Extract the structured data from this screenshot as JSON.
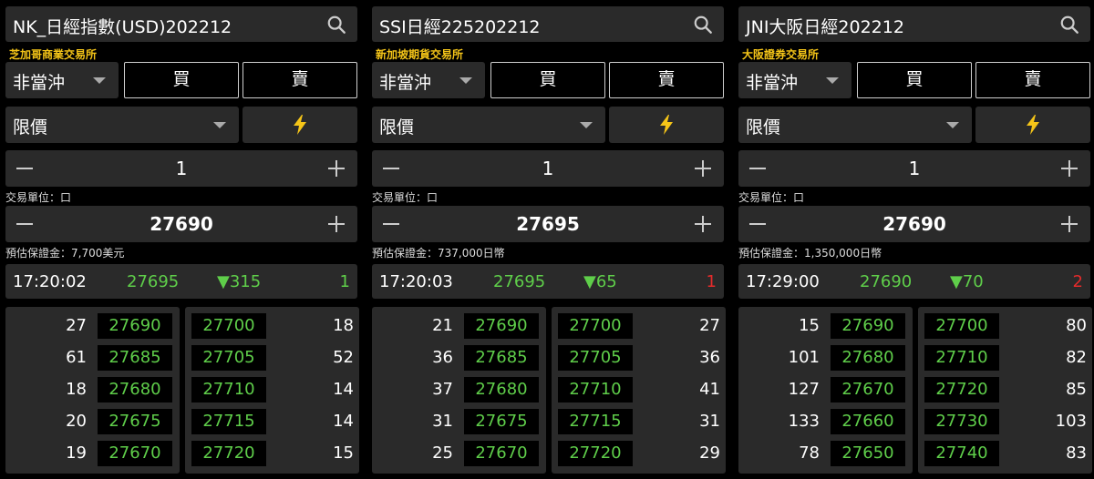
{
  "colors": {
    "up_green": "#5fce4a",
    "down_red": "#e52b2b",
    "exchange_gold": "#f5c518",
    "panel_gray": "#2a2a2a"
  },
  "panels": [
    {
      "title": "NK_日經指數(USD)202212",
      "exchange": "芝加哥商業交易所",
      "order_type": "非當沖",
      "buy_label": "買",
      "sell_label": "賣",
      "price_type": "限價",
      "quantity": "1",
      "unit_label": "交易單位：口",
      "price": "27690",
      "margin_label": "預估保證金：7,700美元",
      "tick": {
        "time": "17:20:02",
        "price": "27695",
        "change": "▼315",
        "volume": "1",
        "volume_color": "up"
      },
      "bids": [
        {
          "qty": "27",
          "price": "27690"
        },
        {
          "qty": "61",
          "price": "27685"
        },
        {
          "qty": "18",
          "price": "27680"
        },
        {
          "qty": "20",
          "price": "27675"
        },
        {
          "qty": "19",
          "price": "27670"
        }
      ],
      "asks": [
        {
          "qty": "18",
          "price": "27700"
        },
        {
          "qty": "52",
          "price": "27705"
        },
        {
          "qty": "14",
          "price": "27710"
        },
        {
          "qty": "14",
          "price": "27715"
        },
        {
          "qty": "15",
          "price": "27720"
        }
      ]
    },
    {
      "title": "SSI日經225202212",
      "exchange": "新加坡期貨交易所",
      "order_type": "非當沖",
      "buy_label": "買",
      "sell_label": "賣",
      "price_type": "限價",
      "quantity": "1",
      "unit_label": "交易單位：口",
      "price": "27695",
      "margin_label": "預估保證金：737,000日幣",
      "tick": {
        "time": "17:20:03",
        "price": "27695",
        "change": "▼65",
        "volume": "1",
        "volume_color": "down"
      },
      "bids": [
        {
          "qty": "21",
          "price": "27690"
        },
        {
          "qty": "36",
          "price": "27685"
        },
        {
          "qty": "37",
          "price": "27680"
        },
        {
          "qty": "31",
          "price": "27675"
        },
        {
          "qty": "25",
          "price": "27670"
        }
      ],
      "asks": [
        {
          "qty": "27",
          "price": "27700"
        },
        {
          "qty": "36",
          "price": "27705"
        },
        {
          "qty": "41",
          "price": "27710"
        },
        {
          "qty": "31",
          "price": "27715"
        },
        {
          "qty": "29",
          "price": "27720"
        }
      ]
    },
    {
      "title": "JNI大阪日經202212",
      "exchange": "大阪證券交易所",
      "order_type": "非當沖",
      "buy_label": "買",
      "sell_label": "賣",
      "price_type": "限價",
      "quantity": "1",
      "unit_label": "交易單位：口",
      "price": "27690",
      "margin_label": "預估保證金：1,350,000日幣",
      "tick": {
        "time": "17:29:00",
        "price": "27690",
        "change": "▼70",
        "volume": "2",
        "volume_color": "down"
      },
      "bids": [
        {
          "qty": "15",
          "price": "27690"
        },
        {
          "qty": "101",
          "price": "27680"
        },
        {
          "qty": "127",
          "price": "27670"
        },
        {
          "qty": "133",
          "price": "27660"
        },
        {
          "qty": "78",
          "price": "27650"
        }
      ],
      "asks": [
        {
          "qty": "80",
          "price": "27700"
        },
        {
          "qty": "82",
          "price": "27710"
        },
        {
          "qty": "85",
          "price": "27720"
        },
        {
          "qty": "103",
          "price": "27730"
        },
        {
          "qty": "83",
          "price": "27740"
        }
      ]
    }
  ]
}
